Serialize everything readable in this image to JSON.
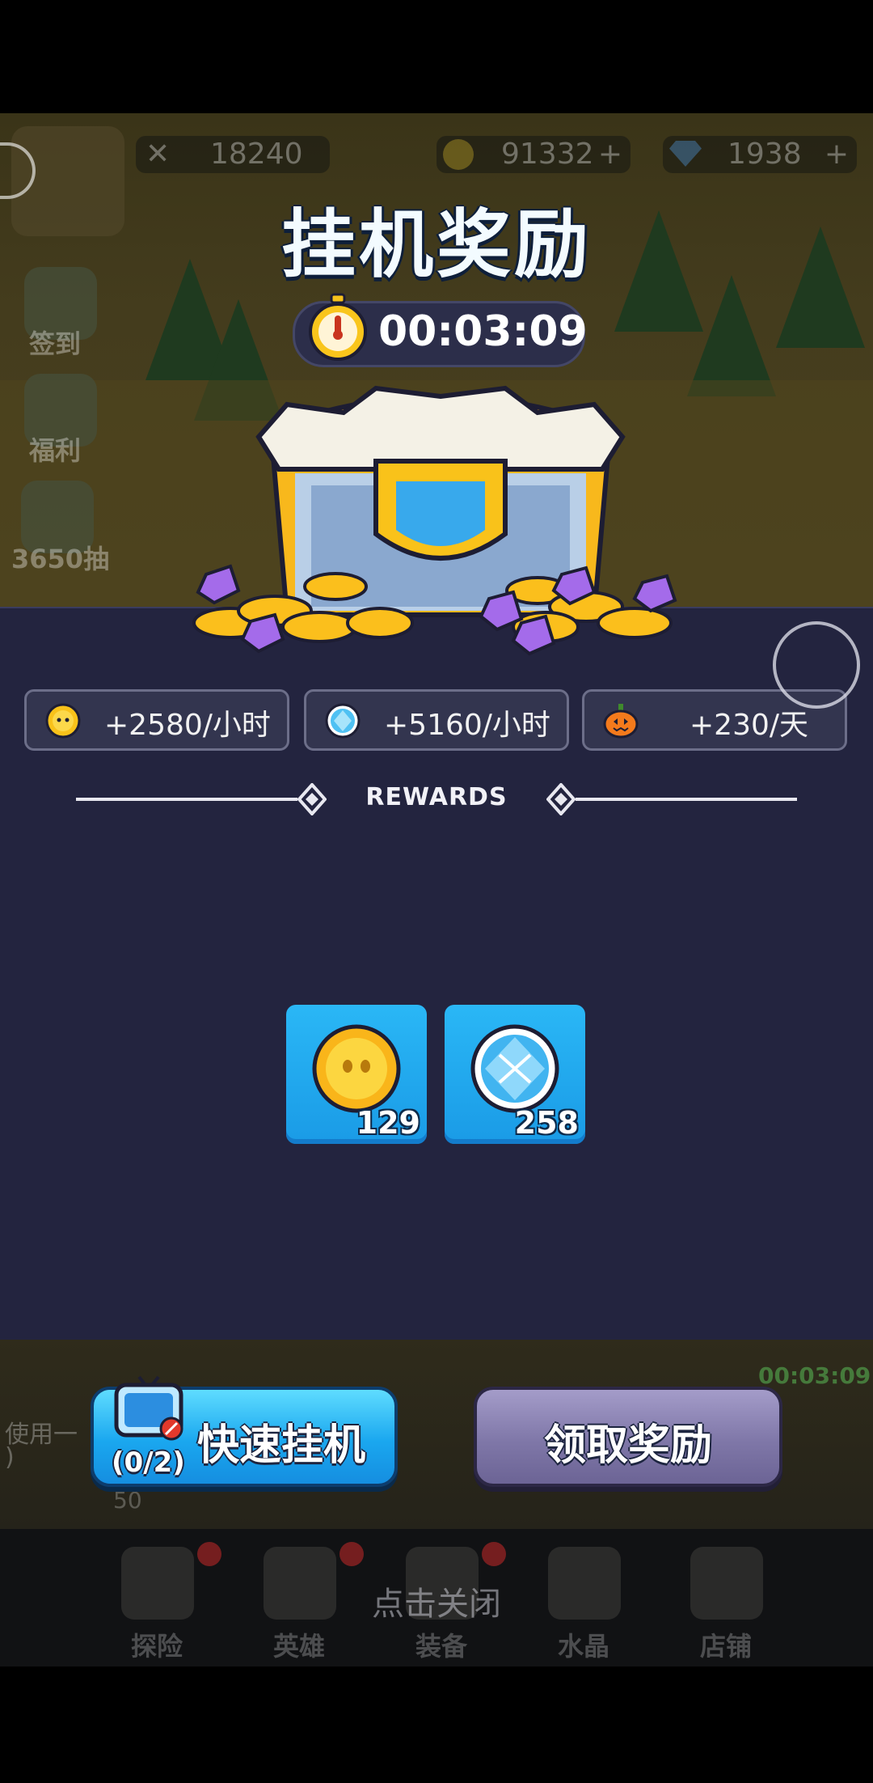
{
  "background": {
    "power": "18240",
    "gold": "91332",
    "gems": "1938",
    "side_buttons": [
      "签到",
      "福利",
      "3650抽"
    ],
    "mini_timer": "00:03:09",
    "hint_text": "使用一",
    "hint_text2": ")",
    "cost": "50"
  },
  "dialog": {
    "title": "挂机奖励",
    "timer": "00:03:09",
    "rates": [
      {
        "icon": "gold-coin-icon",
        "text": "+2580/小时"
      },
      {
        "icon": "crystal-gem-icon",
        "text": "+5160/小时"
      },
      {
        "icon": "pumpkin-icon",
        "text": "+230/天"
      }
    ],
    "rewards_label": "REWARDS",
    "rewards": [
      {
        "icon": "gold-coin-icon",
        "count": "129"
      },
      {
        "icon": "crystal-gem-icon",
        "count": "258"
      }
    ],
    "quick_button": {
      "label": "快速挂机",
      "counter": "(0/2)"
    },
    "claim_button": {
      "label": "领取奖励"
    },
    "close_hint": "点击关闭"
  },
  "nav": {
    "items": [
      "探险",
      "英雄",
      "装备",
      "水晶",
      "店铺"
    ]
  },
  "colors": {
    "panel": "#23243f",
    "tile": "#1fa9f0",
    "quick_button": "#1aa7ef",
    "claim_button": "#7f77a8"
  }
}
